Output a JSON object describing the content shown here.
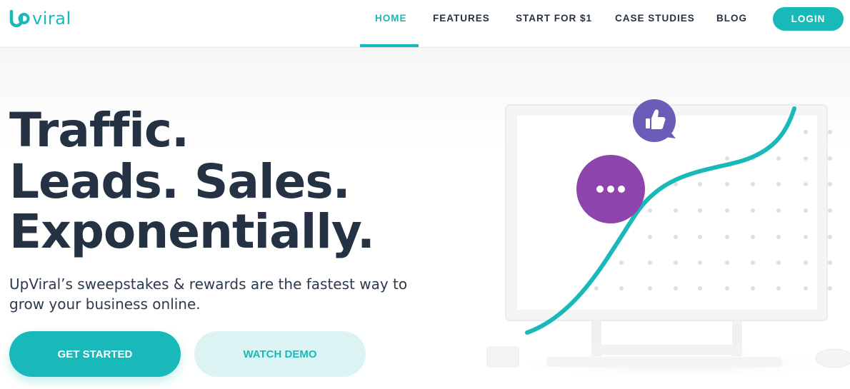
{
  "logo": {
    "text_main": "viral",
    "mark_letter": "u",
    "icon": "upviral-logo-icon"
  },
  "nav": {
    "items": [
      {
        "label": "HOME",
        "active": true
      },
      {
        "label": "FEATURES",
        "active": false
      },
      {
        "label": "START FOR $1",
        "active": false
      },
      {
        "label": "CASE STUDIES",
        "active": false
      },
      {
        "label": "BLOG",
        "active": false
      }
    ],
    "login_label": "LOGIN"
  },
  "hero": {
    "headline_line1": "Traffic.",
    "headline_line2": "Leads. Sales.",
    "headline_line3": "Exponentially.",
    "subtext": "UpViral’s sweepstakes & rewards are the fastest way to grow your business online.",
    "cta_primary": "GET STARTED",
    "cta_secondary": "WATCH DEMO"
  },
  "illustration": {
    "icons": [
      "thumbs-up-icon",
      "chat-bubble-icon",
      "growth-curve"
    ]
  },
  "colors": {
    "accent": "#19b9b9",
    "dark": "#253243",
    "purple_bubble": "#8e44ad",
    "thumb_bubble": "#6c5cb7",
    "light_accent": "#ddf4f4"
  }
}
